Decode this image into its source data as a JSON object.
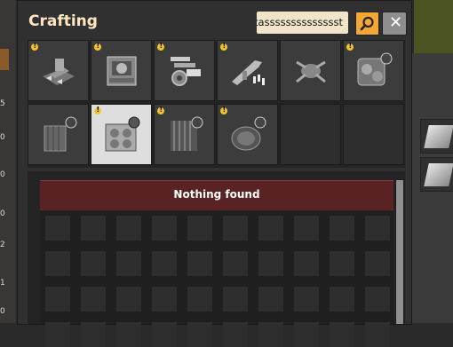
{
  "window": {
    "title": "Crafting"
  },
  "search": {
    "value": "tasssssssssssssst"
  },
  "buttons": {
    "close_glyph": "✕"
  },
  "item_groups": [
    {
      "name": "logistics",
      "warning": true,
      "selected": false
    },
    {
      "name": "production",
      "warning": true,
      "selected": false
    },
    {
      "name": "intermediate-products",
      "warning": true,
      "selected": false
    },
    {
      "name": "combat",
      "warning": true,
      "selected": false
    },
    {
      "name": "enemies",
      "warning": false,
      "selected": false
    },
    {
      "name": "effects",
      "warning": true,
      "selected": false
    },
    {
      "name": "environment",
      "warning": false,
      "selected": false
    },
    {
      "name": "signals",
      "warning": true,
      "selected": true
    },
    {
      "name": "other",
      "warning": true,
      "selected": false
    },
    {
      "name": "unsorted",
      "warning": true,
      "selected": false
    },
    {
      "name": "",
      "warning": false,
      "selected": false
    },
    {
      "name": "",
      "warning": false,
      "selected": false
    }
  ],
  "results": {
    "message": "Nothing found"
  },
  "side_numbers": [
    "5",
    "0",
    "0",
    "0",
    "2",
    "1",
    "0"
  ]
}
